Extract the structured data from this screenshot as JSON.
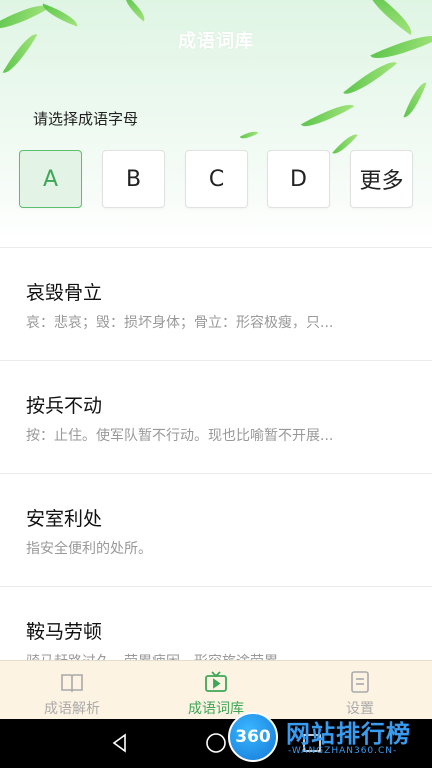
{
  "header": {
    "title": "成语词库",
    "prompt": "请选择成语字母"
  },
  "letters": [
    {
      "label": "A",
      "selected": true
    },
    {
      "label": "B",
      "selected": false
    },
    {
      "label": "C",
      "selected": false
    },
    {
      "label": "D",
      "selected": false
    },
    {
      "label": "更多",
      "selected": false
    }
  ],
  "idioms": [
    {
      "word": "哀毁骨立",
      "desc": "哀：悲哀；毁：损坏身体；骨立：形容极瘦，只..."
    },
    {
      "word": "按兵不动",
      "desc": "按：止住。使军队暂不行动。现也比喻暂不开展..."
    },
    {
      "word": "安室利处",
      "desc": "指安全便利的处所。"
    },
    {
      "word": "鞍马劳顿",
      "desc": "骑马赶路过久，劳累疲困。形容旅途劳累"
    }
  ],
  "tabs": [
    {
      "label": "成语解析",
      "icon": "book-icon",
      "active": false
    },
    {
      "label": "成语词库",
      "icon": "tv-icon",
      "active": true
    },
    {
      "label": "设置",
      "icon": "document-icon",
      "active": false
    }
  ],
  "watermark": {
    "badge": "360",
    "text": "网站排行榜",
    "sub": "-WANGZHAN360.CN-"
  },
  "colors": {
    "accent": "#3ea657",
    "header_bg": "#dff5e4",
    "tabbar_bg": "#fdf3e3"
  }
}
